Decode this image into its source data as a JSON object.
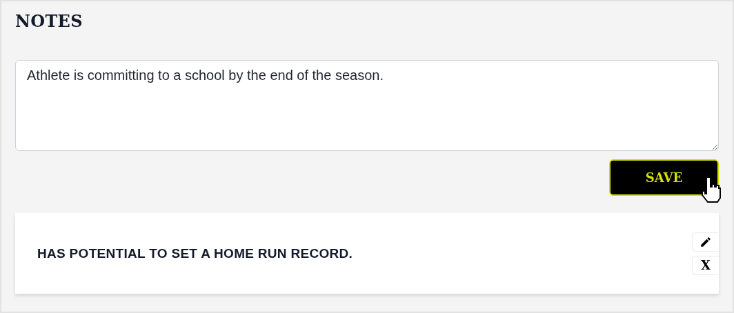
{
  "title": "NOTES",
  "note_input": {
    "value": "Athlete is committing to a school by the end of the season."
  },
  "save_button": {
    "label": "SAVE"
  },
  "notes": [
    {
      "text": "HAS POTENTIAL TO SET A HOME RUN RECORD.",
      "delete_label": "X"
    }
  ]
}
